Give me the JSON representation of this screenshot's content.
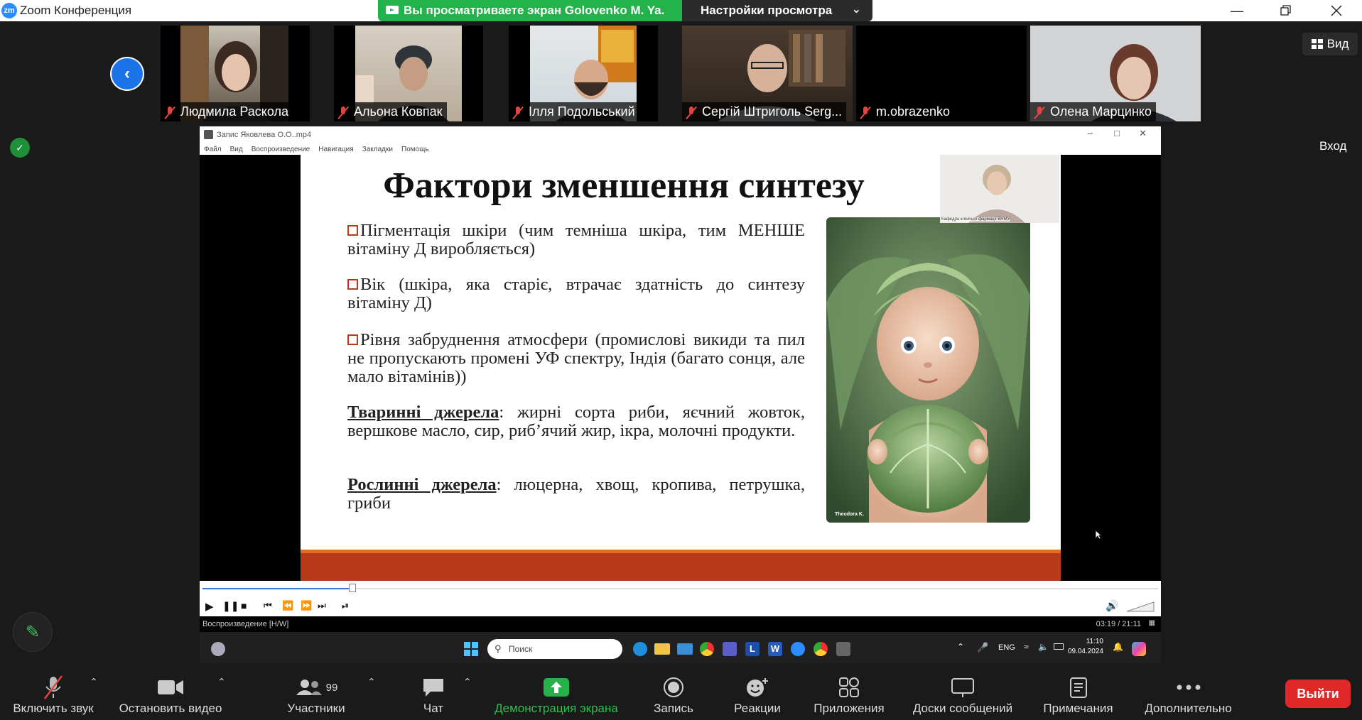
{
  "titlebar": {
    "logo": "zm",
    "title": "Zoom Конференция"
  },
  "share_banner": {
    "text": "Вы просматриваете экран Golovenko M. Ya.",
    "settings": "Настройки просмотра"
  },
  "participants": [
    {
      "name": "Людмила Раскола"
    },
    {
      "name": "Альона Ковпак"
    },
    {
      "name": "Ілля Подольський"
    },
    {
      "name": "Сергій Штриголь Serg..."
    },
    {
      "name": "m.obrazenko"
    },
    {
      "name": "Олена Марцинко"
    }
  ],
  "side": {
    "view_label": "Вид",
    "signin_label": "Вход"
  },
  "player": {
    "title": "Запис Яковлева О.О..mp4",
    "menu": [
      "Файл",
      "Вид",
      "Воспроизведение",
      "Навигация",
      "Закладки",
      "Помощь"
    ],
    "status_left": "Воспроизведение [H/W]",
    "time": "03:19 / 21:11",
    "progress": 0.157
  },
  "slide": {
    "title": "Фактори зменшення синтезу",
    "bullets": [
      "Пігментація шкіри (чим темніша шкіра, тим МЕНШЕ вітаміну Д виробляється)",
      "Вік (шкіра, яка старіє, втрачає здатність до синтезу вітаміну Д)",
      "Рівня забруднення атмосфери (промислові викиди та пил не пропускають промені УФ спектру, Індія (багато сонця, але мало вітамінів))"
    ],
    "animal_label": "Тваринні джерела",
    "animal_text": ": жирні сорта риби, яєчний жовток, вершкове масло, сир, риб’ячий жир, ікра, молочні продукти.",
    "plant_label": "Рослинні джерела",
    "plant_text": ": люцерна, хвощ, кропива, петрушка, гриби",
    "image_caption": "Theodora K.",
    "pip_caption": "Кафедра клінічної фармації ВНМУ"
  },
  "taskbar": {
    "search_placeholder": "Поиск",
    "lang": "ENG",
    "time": "11:10",
    "date": "09.04.2024"
  },
  "toolbar": {
    "unmute": "Включить звук",
    "stop_video": "Остановить видео",
    "participants": "Участники",
    "participants_count": "99",
    "chat": "Чат",
    "share": "Демонстрация экрана",
    "record": "Запись",
    "reactions": "Реакции",
    "apps": "Приложения",
    "whiteboards": "Доски сообщений",
    "notes": "Примечания",
    "more": "Дополнительно",
    "leave": "Выйти"
  }
}
